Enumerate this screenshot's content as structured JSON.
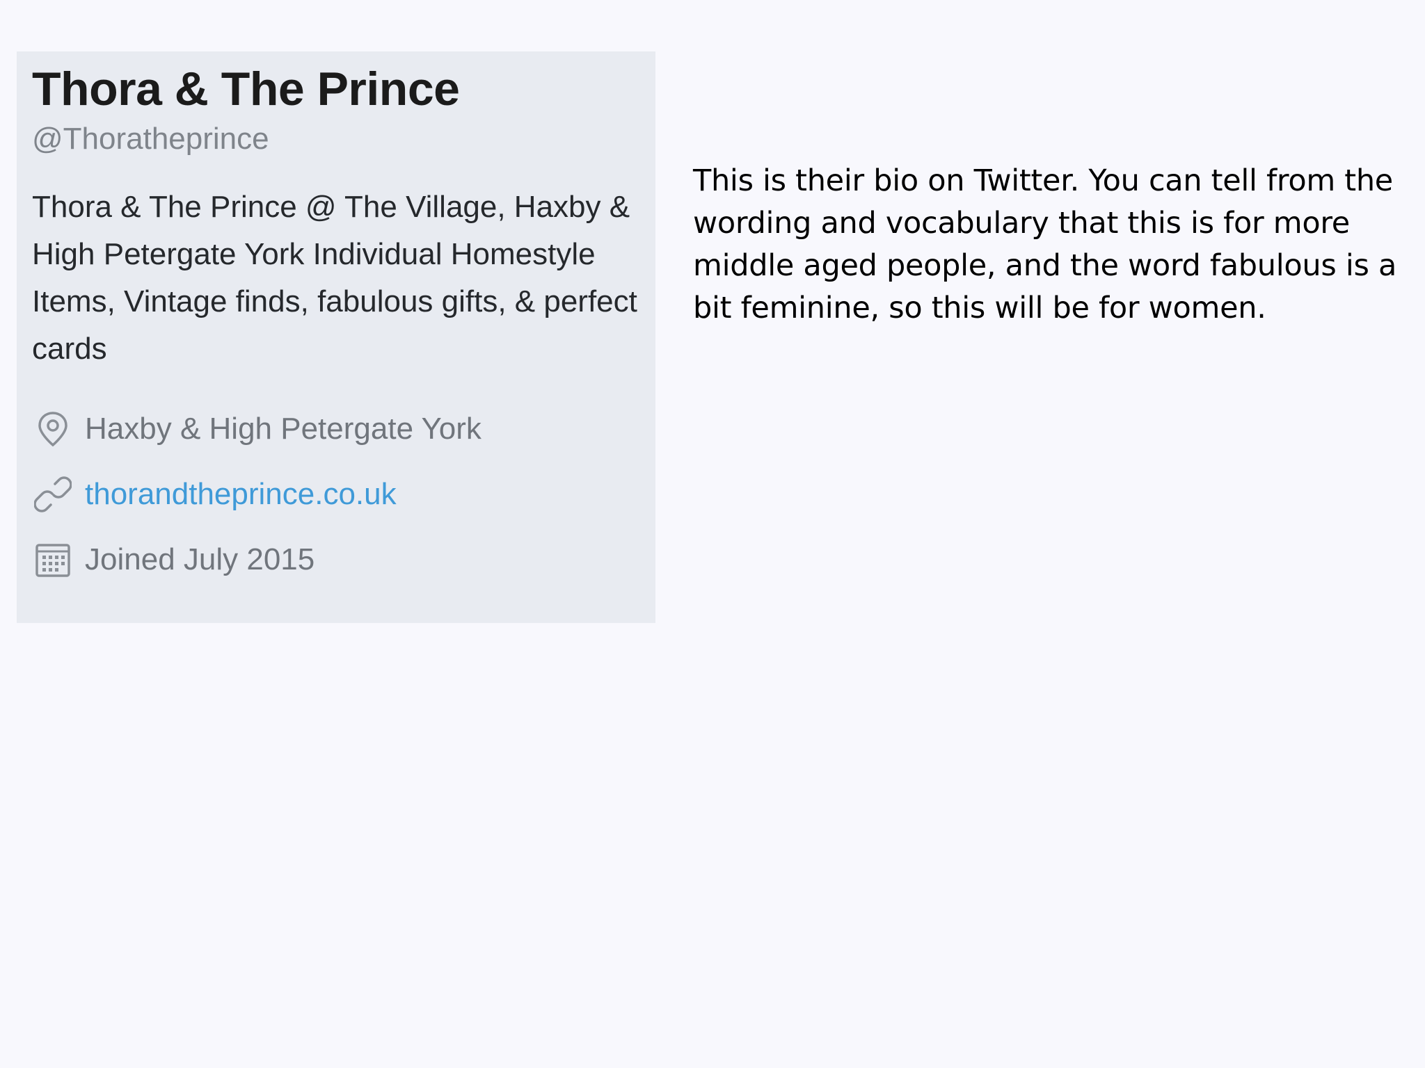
{
  "profile": {
    "name": "Thora & The Prince",
    "handle": "@Thoratheprince",
    "bio": "Thora & The Prince @ The Village, Haxby & High Petergate York Individual Homestyle Items, Vintage finds, fabulous gifts, & perfect cards",
    "location": "Haxby & High Petergate York",
    "location_icon": "location-pin-icon",
    "website": "thorandtheprince.co.uk",
    "website_icon": "link-icon",
    "joined": "Joined July 2015",
    "joined_icon": "calendar-icon",
    "link_color": "#3f9ad8"
  },
  "commentary": {
    "text": "This is their bio on Twitter. You can tell from the wording and vocabulary that this is for more middle aged people, and the word fabulous is a bit feminine, so this will be for women."
  }
}
